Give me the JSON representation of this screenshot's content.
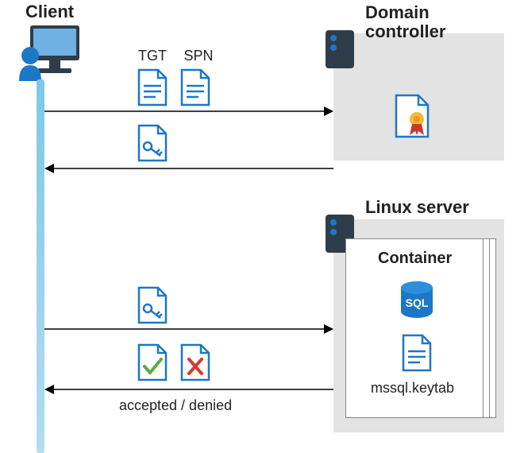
{
  "client": {
    "label": "Client"
  },
  "domain_controller": {
    "label": "Domain\ncontroller"
  },
  "linux_server": {
    "label": "Linux server"
  },
  "container": {
    "label": "Container",
    "sql_tag": "SQL",
    "keytab_label": "mssql.keytab"
  },
  "flow1": {
    "tgt_label": "TGT",
    "spn_label": "SPN"
  },
  "flow4": {
    "caption": "accepted / denied"
  },
  "colors": {
    "blue": "#1d77c7",
    "lightblue": "#7ec7e8",
    "gray_box": "#e3e3e3",
    "server_dark": "#2f3d4a",
    "green": "#5fa944",
    "red": "#d63a2f",
    "ribbon_red": "#c53a2e",
    "seal_gold": "#f0b93c"
  }
}
